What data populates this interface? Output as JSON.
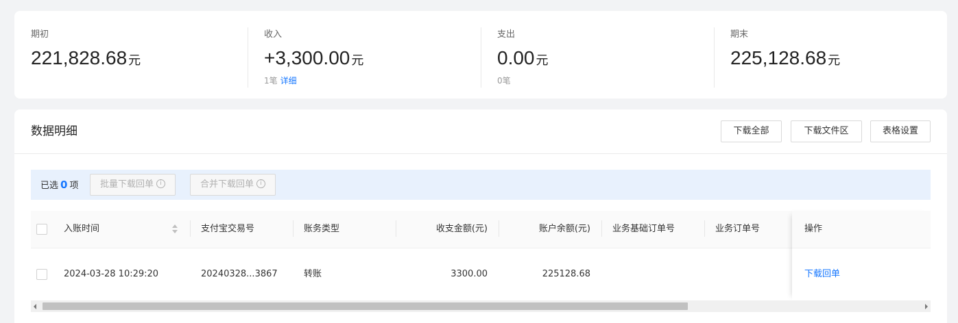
{
  "summary": {
    "opening": {
      "label": "期初",
      "value": "221,828.68",
      "unit": "元"
    },
    "income": {
      "label": "收入",
      "value": "+3,300.00",
      "unit": "元",
      "count": "1笔",
      "detail_link": "详细"
    },
    "expense": {
      "label": "支出",
      "value": "0.00",
      "unit": "元",
      "count": "0笔"
    },
    "closing": {
      "label": "期末",
      "value": "225,128.68",
      "unit": "元"
    }
  },
  "detail": {
    "title": "数据明细",
    "buttons": {
      "download_all": "下载全部",
      "download_files": "下载文件区",
      "table_settings": "表格设置"
    },
    "selection": {
      "prefix": "已选",
      "count": "0",
      "suffix": "项",
      "batch_download": "批量下载回单",
      "merge_download": "合并下载回单"
    },
    "table": {
      "columns": [
        "入账时间",
        "支付宝交易号",
        "账务类型",
        "收支金额(元)",
        "账户余额(元)",
        "业务基础订单号",
        "业务订单号",
        "操作"
      ],
      "rows": [
        {
          "time": "2024-03-28 10:29:20",
          "trade_no": "20240328...3867",
          "type": "转账",
          "amount": "3300.00",
          "balance": "225128.68",
          "base_order": "",
          "order": "",
          "action": "下载回单"
        }
      ]
    }
  },
  "colors": {
    "accent": "#1677ff",
    "page_bg": "#f2f3f5",
    "selection_bg": "#e8f1fd"
  },
  "icons": {
    "info": "info-circle-icon",
    "sort": "sort-icon"
  }
}
